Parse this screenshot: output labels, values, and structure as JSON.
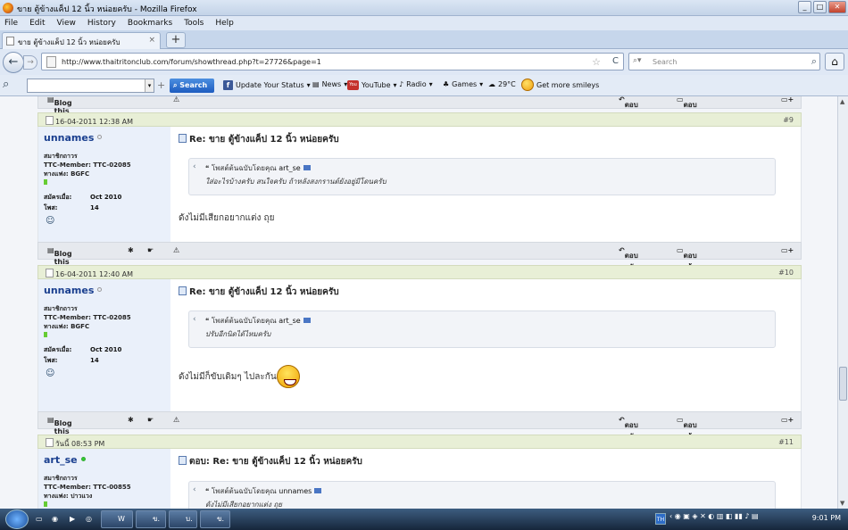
{
  "window": {
    "title": "ขาย ตู้ข้างแค็ป 12 นิ้ว หน่อยครับ - Mozilla Firefox",
    "buttons": [
      "_",
      "□",
      "✕"
    ]
  },
  "menu": [
    "File",
    "Edit",
    "View",
    "History",
    "Bookmarks",
    "Tools",
    "Help"
  ],
  "tab": {
    "label": "ขาย ตู้ข้างแค็ป 12 นิ้ว หน่อยครับ",
    "close": "×",
    "new": "+"
  },
  "nav": {
    "back": "←",
    "forward": "→",
    "url": "http://www.thaitritonclub.com/forum/showthread.php?t=27726&page=1",
    "star": "☆",
    "reload": "C",
    "search_placeholder": "Search",
    "home": "⌂"
  },
  "toolbar": {
    "search_btn": "Search",
    "update_status": "Update Your Status",
    "news": "News",
    "youtube": "YouTube",
    "radio": "Radio",
    "games": "Games",
    "weather": "29°C",
    "smileys": "Get more smileys"
  },
  "blog_label": "Blog this Post",
  "reply_label": "ตอบกลับ",
  "quote_reply_label": "ตอบพร้อมอ้างข้อความ",
  "quote_prefix": "โพสต์ต้นฉบับโดยคุณ",
  "posts": [
    {
      "date": "16-04-2011 12:38 AM",
      "num": "#9",
      "user": "unnames",
      "rank": "สมาชิกถาวร",
      "member": "TTC-Member: TTC-02085",
      "team": "ทางแฟง: BGFC",
      "joined_label": "สมัครเมื่อ:",
      "joined": "Oct 2010",
      "posts_label": "โพส:",
      "posts": "14",
      "title": "Re: ขาย ตู้ข้างแค็ป 12 นิ้ว หน่อยครับ",
      "quote_author": "art_se",
      "quote_text": "ใส่อะไรบ้างครับ สนใจครับ ถ้าหลังสงกรานต์ยังอยู่มีโดนครับ",
      "text": "ดังไม่มีเสียกอยากแต่ง ถุย"
    },
    {
      "date": "16-04-2011 12:40 AM",
      "num": "#10",
      "user": "unnames",
      "rank": "สมาชิกถาวร",
      "member": "TTC-Member: TTC-02085",
      "team": "ทางแฟง: BGFC",
      "joined_label": "สมัครเมื่อ:",
      "joined": "Oct 2010",
      "posts_label": "โพส:",
      "posts": "14",
      "title": "Re: ขาย ตู้ข้างแค็ป 12 นิ้ว หน่อยครับ",
      "quote_author": "art_se",
      "quote_text": "ปรับอีกนิดได้ไหมครับ",
      "text": "ดังไม่มีก็ขับเดิมๆ ไปละกัน"
    },
    {
      "date": "วันนี้ 08:53 PM",
      "num": "#11",
      "user": "art_se",
      "rank": "สมาชิกถาวร",
      "member": "TTC-Member: TTC-00855",
      "team": "ทางแฟง: ปาวแวง",
      "title": "ตอบ: Re: ขาย ตู้ข้างแค็ป 12 นิ้ว หน่อยครับ",
      "quote_author": "unnames",
      "quote_text": "ดังไม่มีเสียกอยากแต่ง ถุย"
    }
  ],
  "taskbar": {
    "items": [
      "W",
      "ข.",
      "บ.",
      "ข."
    ],
    "lang": "TH",
    "time": "9:01 PM"
  }
}
